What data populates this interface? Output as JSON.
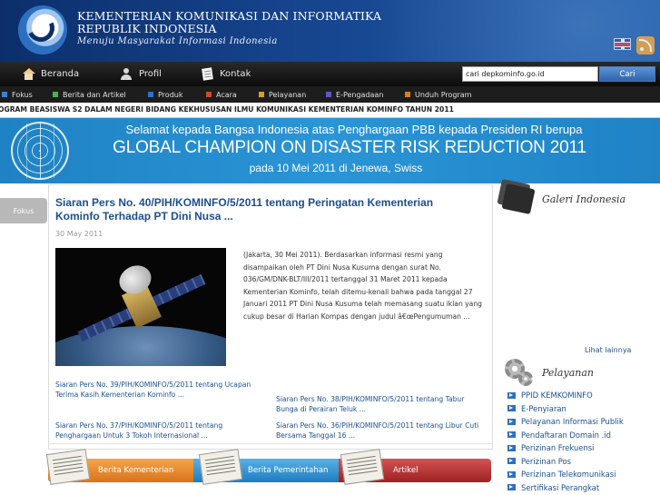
{
  "header": {
    "org_line1": "KEMENTERIAN KOMUNIKASI DAN INFORMATIKA",
    "org_line2": "REPUBLIK INDONESIA",
    "tagline": "Menuju Masyarakat Informasi Indonesia",
    "icons": [
      "logo-emblem",
      "uk-flag-icon",
      "rss-icon"
    ]
  },
  "main_nav": {
    "items": [
      {
        "label": "Beranda",
        "icon": "home-icon"
      },
      {
        "label": "Profil",
        "icon": "user-icon"
      },
      {
        "label": "Kontak",
        "icon": "document-icon"
      }
    ]
  },
  "search": {
    "value": "cari depkominfo.go.id",
    "button_label": "Cari"
  },
  "category_nav": {
    "items": [
      {
        "label": "Fokus",
        "color": "#3a7fd6"
      },
      {
        "label": "Berita dan Artikel",
        "color": "#4caf50"
      },
      {
        "label": "Produk",
        "color": "#2f6fc7"
      },
      {
        "label": "Acara",
        "color": "#c94c2f"
      },
      {
        "label": "Pelayanan",
        "color": "#d6a01e"
      },
      {
        "label": "E-Pengadaan",
        "color": "#5b5bb8"
      },
      {
        "label": "Unduh Program",
        "color": "#d4801f"
      }
    ]
  },
  "ticker": {
    "text": "OGRAM BEASISWA S2 DALAM NEGERI BIDANG KEKHUSUSAN ILMU KOMUNIKASI KEMENTERIAN KOMINFO TAHUN 2011"
  },
  "banner": {
    "line1": "Selamat kepada Bangsa Indonesia atas Penghargaan PBB kepada Presiden RI berupa",
    "line2": "GLOBAL CHAMPION ON DISASTER RISK REDUCTION 2011",
    "line3": "pada 10 Mei 2011 di Jenewa, Swiss"
  },
  "featured": {
    "tab_label": "Fokus",
    "title": "Siaran Pers No. 40/PIH/KOMINFO/5/2011 tentang Peringatan Kementerian Kominfo Terhadap PT Dini Nusa ...",
    "date": "30 May 2011",
    "excerpt": "(Jakarta, 30 Mei 2011). Berdasarkan informasi resmi yang disampaikan oleh PT Dini Nusa Kusuma dengan surat No. 036/GM/DNK-BLT/III/2011 tertanggal 31 Maret 2011 kepada Kementerian Kominfo, telah ditemu-kenali bahwa pada tanggal 27 Januari 2011 PT Dini Nusa Kusuma telah memasang suatu iklan yang cukup besar di Harian Kompas dengan judul â€œPengumuman ..."
  },
  "related": [
    "Siaran Pers No. 39/PIH/KOMINFO/5/2011 tentang Ucapan Terima Kasih Kementerian Kominfo ...",
    "Siaran Pers No. 38/PIH/KOMINFO/5/2011 tentang Tabur Bunga di Perairan Teluk ...",
    "Siaran Pers No. 37/PIH/KOMINFO/5/2011 tentang Penghargaan Untuk 3 Tokoh Internasional ...",
    "Siaran Pers No. 36/PIH/KOMINFO/5/2011 tentang Libur Cuti Bersama Tanggal 16 ..."
  ],
  "news_tabs": [
    "Berita Kementerian",
    "Berita Pemerintahan",
    "Artikel"
  ],
  "sidebar": {
    "gallery_title": "Galeri Indonesia",
    "more_link": "Lihat lainnya",
    "services_title": "Pelayanan",
    "services": [
      "PPID KEMKOMINFO",
      "E-Penyiaran",
      "Pelayanan Informasi Publik",
      "Pendaftaran Domain .id",
      "Perizinan Frekuensi",
      "Perizinan Pos",
      "Perizinan Telekomunikasi",
      "Sertifikasi Perangkat"
    ]
  }
}
